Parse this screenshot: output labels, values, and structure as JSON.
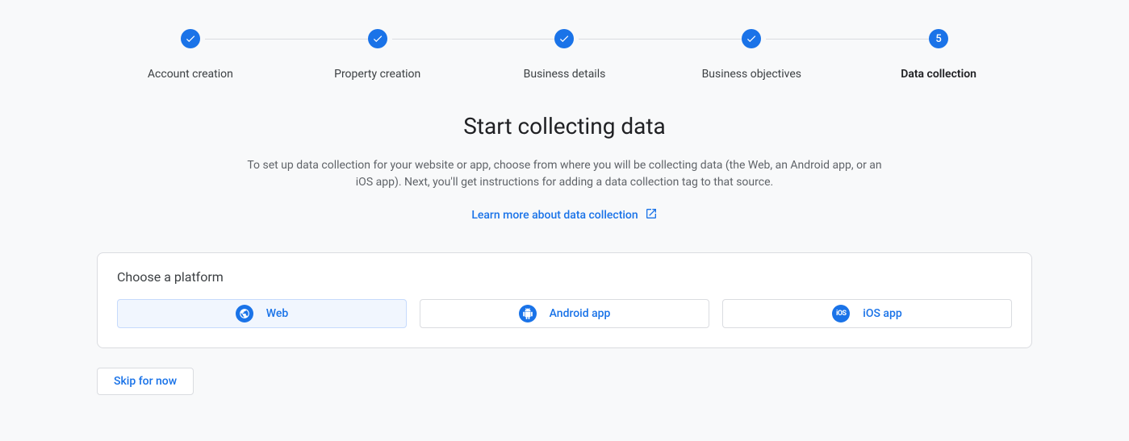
{
  "stepper": {
    "steps": [
      {
        "label": "Account creation",
        "state": "done"
      },
      {
        "label": "Property creation",
        "state": "done"
      },
      {
        "label": "Business details",
        "state": "done"
      },
      {
        "label": "Business objectives",
        "state": "done"
      },
      {
        "label": "Data collection",
        "state": "current",
        "number": "5"
      }
    ]
  },
  "main": {
    "heading": "Start collecting data",
    "description": "To set up data collection for your website or app, choose from where you will be collecting data (the Web, an Android app, or an iOS app). Next, you'll get instructions for adding a data collection tag to that source.",
    "learn_more_label": "Learn more about data collection"
  },
  "platform_card": {
    "title": "Choose a platform",
    "options": {
      "web": "Web",
      "android": "Android app",
      "ios": "iOS app"
    }
  },
  "footer": {
    "skip_label": "Skip for now"
  },
  "colors": {
    "primary": "#1a73e8",
    "background": "#f8f9fa",
    "border": "#dadce0",
    "text": "#3c4043",
    "muted": "#5f6368"
  }
}
